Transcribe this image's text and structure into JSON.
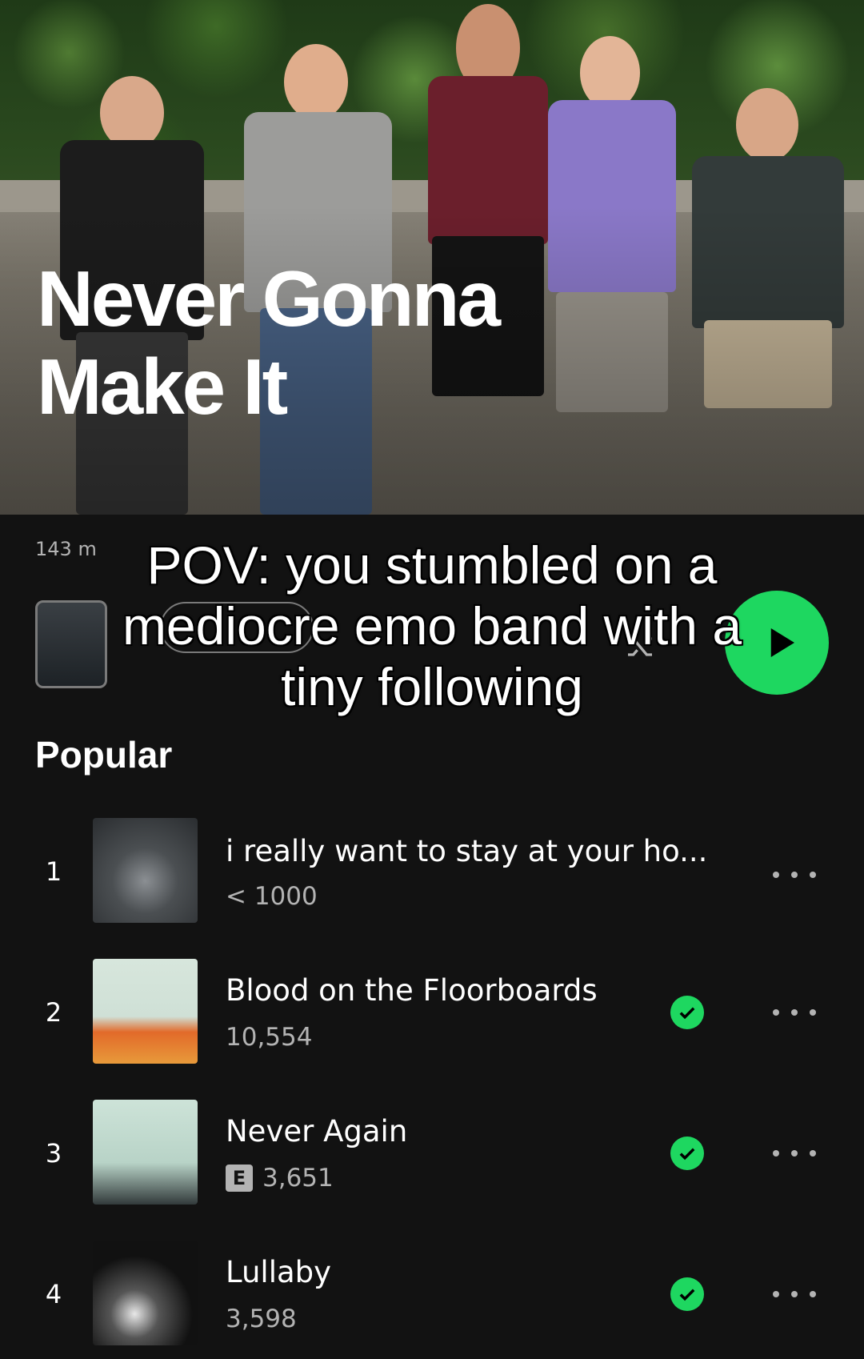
{
  "artist": {
    "name_line1": "Never Gonna",
    "name_line2": "Make It",
    "listeners_prefix": "143 m"
  },
  "caption": {
    "line1": "POV: you stumbled on a",
    "line2": "mediocre emo band with a",
    "line3": "tiny following"
  },
  "popular": {
    "title": "Popular",
    "tracks": [
      {
        "number": "1",
        "title": "i really want to stay at your ho...",
        "plays": "< 1000",
        "explicit": false,
        "saved": false
      },
      {
        "number": "2",
        "title": "Blood on the Floorboards",
        "plays": "10,554",
        "explicit": false,
        "saved": true
      },
      {
        "number": "3",
        "title": "Never Again",
        "plays": "3,651",
        "explicit": true,
        "explicit_label": "E",
        "saved": true
      },
      {
        "number": "4",
        "title": "Lullaby",
        "plays": "3,598",
        "explicit": false,
        "saved": true
      }
    ]
  },
  "icons": {
    "play": "play-icon",
    "shuffle": "shuffle-icon",
    "saved": "check-circle-icon",
    "more": "more-horizontal-icon"
  },
  "colors": {
    "accent": "#1ed760",
    "background": "#121212",
    "secondary_text": "#b3b3b3"
  }
}
